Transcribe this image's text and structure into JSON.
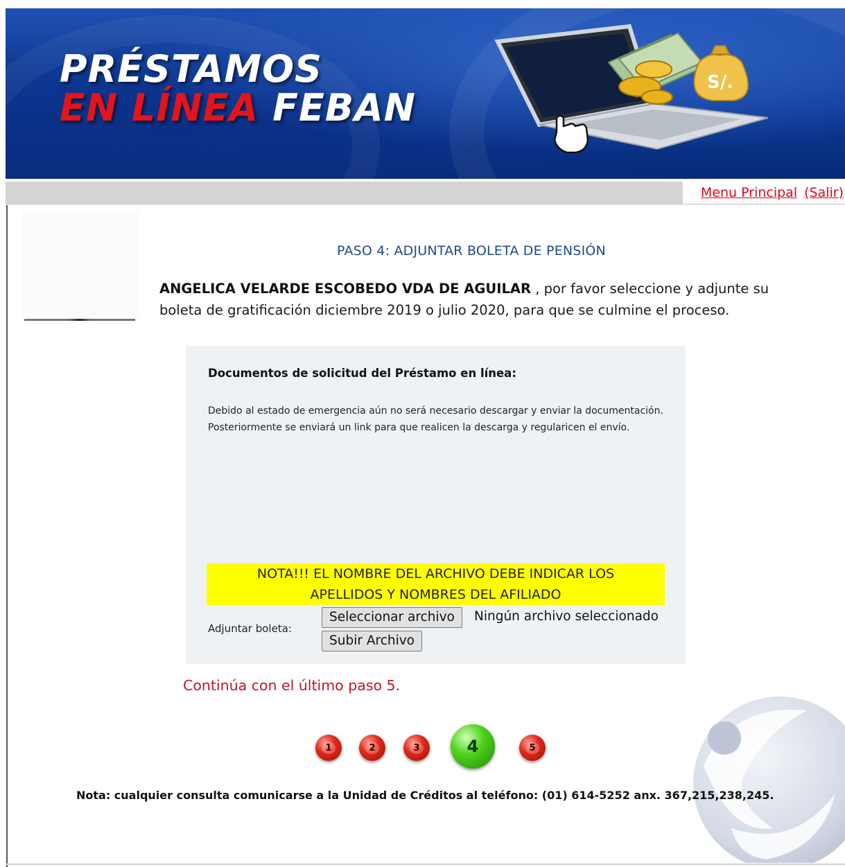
{
  "banner": {
    "title_line1": "PRÉSTAMOS",
    "title_line2_red": "EN LÍNEA",
    "title_line2_white": "FEBAN",
    "bag_label": "S/."
  },
  "nav": {
    "menu_principal": "Menu Principal",
    "salir": "(Salir)",
    "link_color": "#d60a1f"
  },
  "step": {
    "title": "PASO 4: ADJUNTAR BOLETA DE PENSIÓN",
    "applicant_name": "ANGELICA VELARDE ESCOBEDO VDA DE AGUILAR",
    "instruction": " , por favor seleccione y adjunte su boleta de gratificación diciembre 2019 o julio 2020, para que se culmine el proceso."
  },
  "panel": {
    "heading": "Documentos de solicitud del Préstamo en línea:",
    "text": "Debido al estado de emergencia aún no será necesario descargar y enviar la documentación. Posteriormente se enviará un link para que realicen la descarga y regularicen el envío.",
    "note_line1": "NOTA!!! EL NOMBRE DEL ARCHIVO DEBE INDICAR LOS",
    "note_line2": "APELLIDOS Y NOMBRES DEL AFILIADO",
    "note_color": "#ffff00",
    "attach_label": "Adjuntar boleta:",
    "select_button": "Seleccionar archivo",
    "file_status": "Ningún archivo seleccionado",
    "upload_button": "Subir Archivo"
  },
  "continue_text": "Continúa con el último paso 5.",
  "steps": {
    "items": [
      "1",
      "2",
      "3",
      "4",
      "5"
    ],
    "current": "4",
    "current_color": "#4fd21c",
    "other_color": "#e0291b"
  },
  "footer_note": "Nota: cualquier consulta comunicarse a la Unidad de Créditos al teléfono: (01) 614-5252 anx. 367,215,238,245."
}
